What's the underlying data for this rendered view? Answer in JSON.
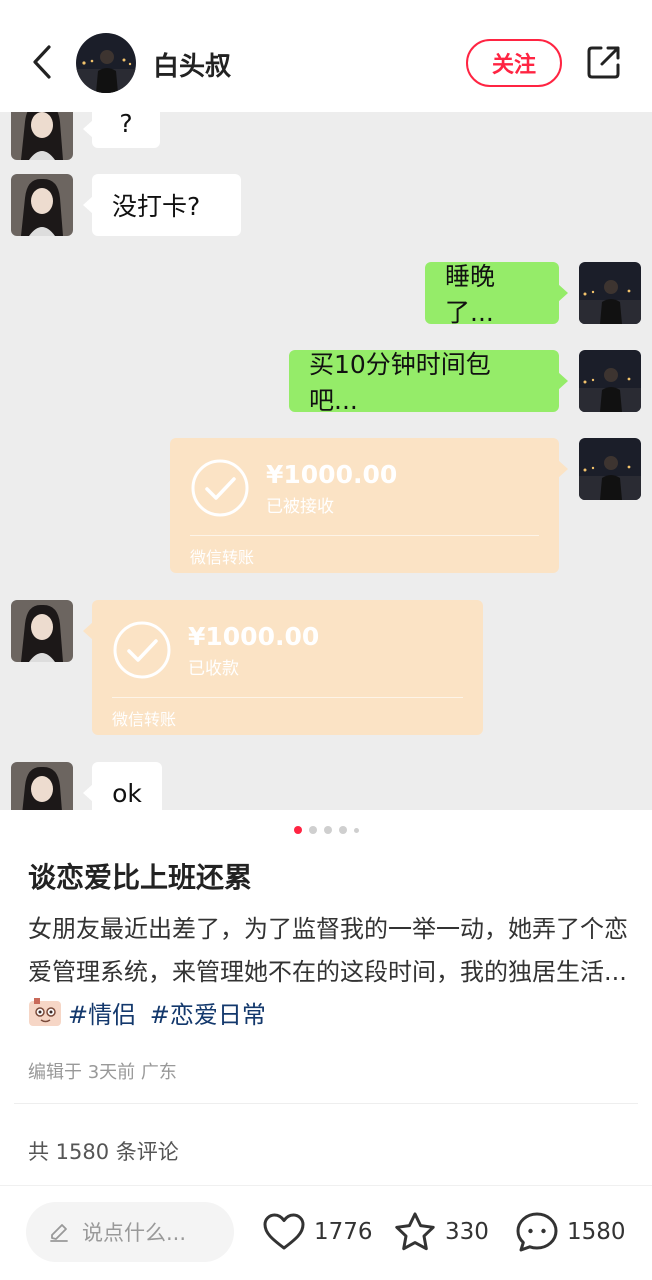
{
  "header": {
    "author_name": "白头叔",
    "follow_label": "关注"
  },
  "chat": {
    "messages": [
      {
        "side": "left",
        "type": "text",
        "text": "?"
      },
      {
        "side": "left",
        "type": "text",
        "text": "没打卡?"
      },
      {
        "side": "right",
        "type": "text",
        "text": "睡晚了..."
      },
      {
        "side": "right",
        "type": "text",
        "text": "买10分钟时间包吧..."
      },
      {
        "side": "right",
        "type": "transfer",
        "amount": "¥1000.00",
        "status": "已被接收",
        "footer": "微信转账"
      },
      {
        "side": "left",
        "type": "transfer",
        "amount": "¥1000.00",
        "status": "已收款",
        "footer": "微信转账"
      },
      {
        "side": "left",
        "type": "text",
        "text": "ok"
      }
    ]
  },
  "carousel": {
    "total": 5,
    "active": 1
  },
  "post": {
    "title": "谈恋爱比上班还累",
    "body": "女朋友最近出差了，为了监督我的一举一动，她弄了个恋爱管理系统，来管理她不在的这段时间，我的独居生活...",
    "tags": [
      "#情侣",
      "#恋爱日常"
    ],
    "meta": "编辑于 3天前 广东",
    "comments_summary": "共 1580 条评论"
  },
  "bottom_bar": {
    "comment_placeholder": "说点什么...",
    "likes": "1776",
    "stars": "330",
    "comments": "1580"
  },
  "colors": {
    "accent": "#ff2442",
    "chat_bg": "#ededed",
    "bubble_green": "#95ec69",
    "transfer": "#fbe3c5",
    "tag": "#13386c"
  }
}
